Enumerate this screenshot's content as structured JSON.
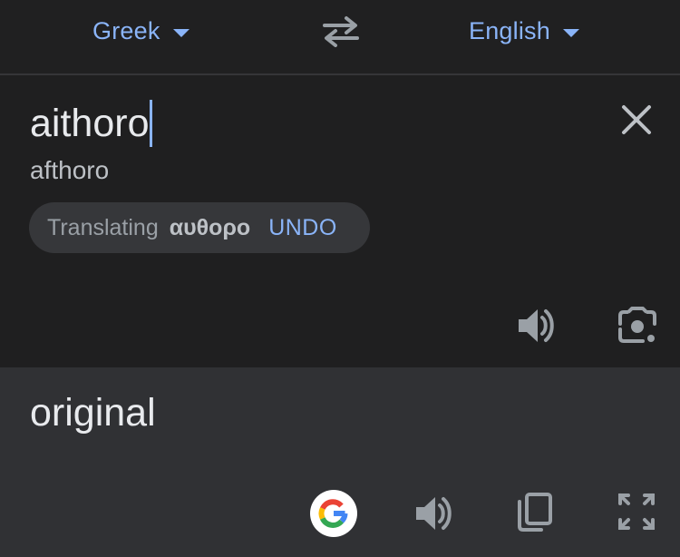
{
  "header": {
    "source_language": "Greek",
    "target_language": "English",
    "source_caret_icon": "arrow-drop-down",
    "target_caret_icon": "arrow-drop-down",
    "swap_icon": "swap-arrows"
  },
  "source": {
    "input_text": "aithoro",
    "transliteration": "afthoro",
    "suggestion": {
      "prefix": "Translating",
      "greek_text": "αυθορο",
      "undo_label": "UNDO"
    },
    "clear_icon": "close",
    "listen_icon": "volume-up",
    "camera_icon": "camera-lens"
  },
  "result": {
    "translation": "original",
    "google_icon": "google-g",
    "listen_icon": "volume-up",
    "copy_icon": "content-copy",
    "fullscreen_icon": "fullscreen"
  },
  "colors": {
    "accent": "#8ab4f8",
    "background": "#1f1f20",
    "result_background": "#303134",
    "text_primary": "#e8eaed",
    "text_secondary": "#bdc1c6",
    "icon": "#9aa0a6"
  }
}
